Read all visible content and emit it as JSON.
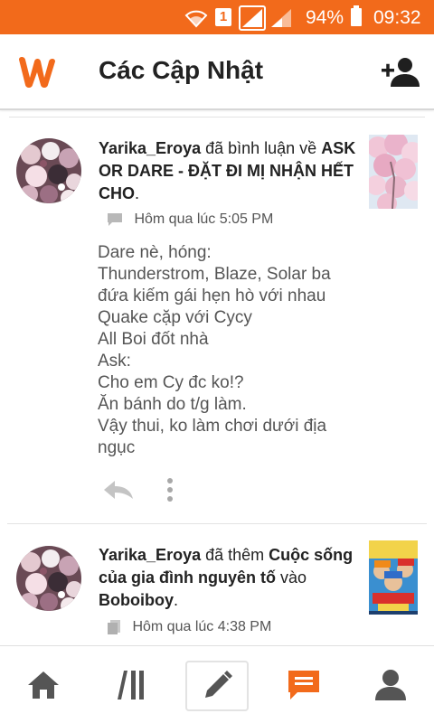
{
  "status_bar": {
    "sim_slot": "1",
    "battery_percent": "94%",
    "time": "09:32"
  },
  "app_bar": {
    "title": "Các Cập Nhật"
  },
  "feed": {
    "items": [
      {
        "user": "Yarika_Eroya",
        "action": " đã bình luận về ",
        "story": "ASK OR DARE - ĐẶT ĐI MỊ NHẬN HẾT CHO",
        "suffix": ".",
        "timestamp": "Hôm qua lúc 5:05 PM",
        "comment_lines": [
          "Dare nè, hóng:",
          "Thunderstrom, Blaze, Solar ba",
          "đứa kiếm gái hẹn hò với nhau",
          "Quake cặp với Cycy",
          "All Boi đốt nhà",
          "Ask:",
          "Cho em Cy đc ko!?",
          "Ăn bánh do t/g làm.",
          "Vậy thui, ko làm chơi dưới địa",
          "ngục"
        ]
      },
      {
        "user": "Yarika_Eroya",
        "action": " đã thêm ",
        "story": "Cuộc sống của gia đình nguyên tố",
        "middle": " vào ",
        "list": "Boboiboy",
        "suffix": ".",
        "timestamp": "Hôm qua lúc 4:38 PM"
      }
    ]
  },
  "colors": {
    "brand": "#f26a1b",
    "icon_gray": "#555555"
  }
}
